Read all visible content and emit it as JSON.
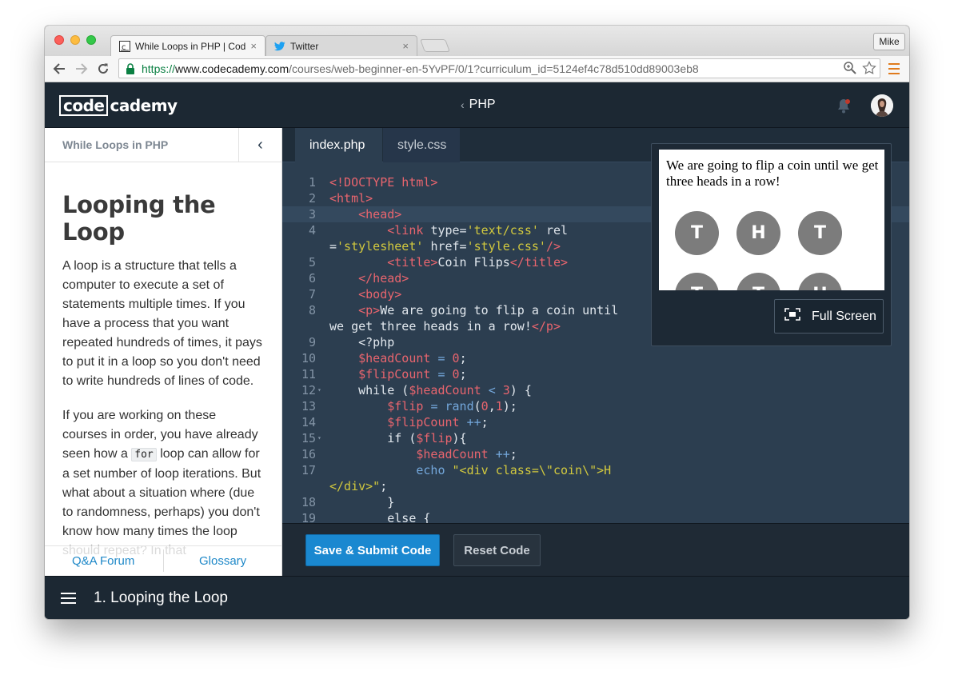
{
  "browser": {
    "tabs": [
      {
        "title": "While Loops in PHP | Codecademy",
        "active": true,
        "favicon": "codecademy-favicon"
      },
      {
        "title": "Twitter",
        "active": false,
        "favicon": "twitter-bird-icon"
      }
    ],
    "close_glyph": "×",
    "profile": "Mike",
    "url": {
      "scheme": "https://",
      "host": "www.codecademy.com",
      "path": "/courses/web-beginner-en-5YvPF/0/1?curriculum_id=5124ef4c78d510dd89003eb8"
    }
  },
  "app": {
    "logo_boxed": "code",
    "logo_plain": "cademy",
    "course_chevron": "‹",
    "course_title": "PHP"
  },
  "lesson": {
    "section_title": "While Loops in PHP",
    "collapse_glyph": "‹",
    "heading": "Looping the Loop",
    "paragraph1": "A loop is a structure that tells a computer to execute a set of statements multiple times. If you have a process that you want repeated hundreds of times, it pays to put it in a loop so you don't need to write hundreds of lines of code.",
    "paragraph2_before": "If you are working on these courses in order, you have already seen how a ",
    "paragraph2_code": "for",
    "paragraph2_after": " loop can allow for a set number of loop iterations. But what about a situation where (due to randomness, perhaps) you don't know how many times the loop should repeat? In that",
    "footer": {
      "qa": "Q&A Forum",
      "glossary": "Glossary"
    }
  },
  "editor": {
    "tabs": [
      "index.php",
      "style.css"
    ],
    "line_numbers": [
      "1",
      "2",
      "3",
      "4",
      "",
      "5",
      "6",
      "7",
      "8",
      "",
      "9",
      "10",
      "11",
      "12",
      "13",
      "14",
      "15",
      "16",
      "17",
      "",
      "18",
      "19"
    ],
    "fold_marker": "▾"
  },
  "preview": {
    "text": "We are going to flip a coin until we get three heads in a row!",
    "coins_row1": [
      "T",
      "H",
      "T"
    ],
    "coins_row2": [
      "T",
      "T",
      "H"
    ],
    "fullscreen_label": "Full Screen"
  },
  "actions": {
    "submit_label": "Save & Submit Code",
    "reset_label": "Reset Code"
  },
  "footer": {
    "exercise_title": "1. Looping the Loop"
  },
  "colors": {
    "header_bg": "#1c2833",
    "editor_bg": "#2c3e50",
    "submit_blue": "#1a88d0",
    "tag_red": "#e9656e",
    "string_yellow": "#d2c93e",
    "function_blue": "#74a8dc"
  }
}
